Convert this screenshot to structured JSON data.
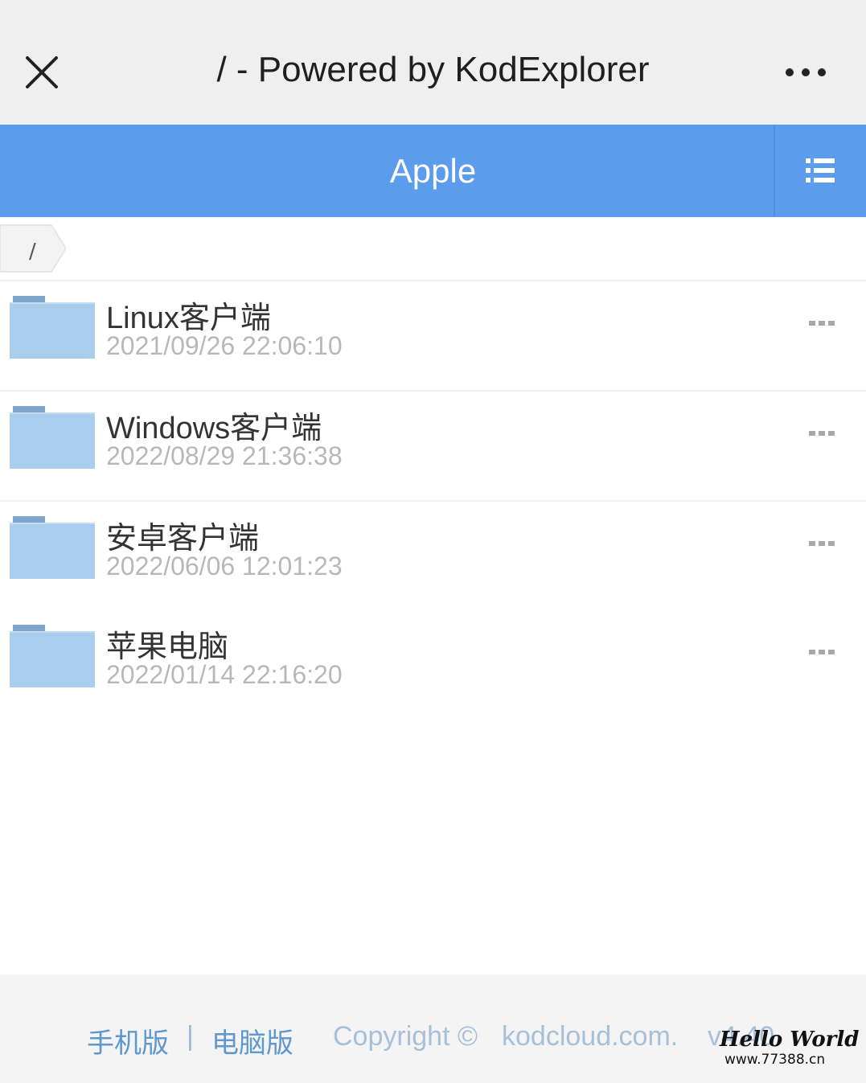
{
  "browser": {
    "title": "/ - Powered by KodExplorer",
    "close_icon": "close-icon",
    "more_icon": "more-icon"
  },
  "header": {
    "title": "Apple",
    "menu_icon": "list-menu-icon"
  },
  "breadcrumb": {
    "path": "/"
  },
  "files": [
    {
      "name": "Linux客户端",
      "date": "2021/09/26 22:06:10",
      "icon": "folder-icon"
    },
    {
      "name": "Windows客户端",
      "date": "2022/08/29 21:36:38",
      "icon": "folder-icon"
    },
    {
      "name": "安卓客户端",
      "date": "2022/06/06 12:01:23",
      "icon": "folder-icon"
    },
    {
      "name": "苹果电脑",
      "date": "2022/01/14 22:16:20",
      "icon": "folder-icon"
    }
  ],
  "footer": {
    "mobile_link": "手机版",
    "separator": "|",
    "desktop_link": "电脑版",
    "copyright_prefix": "Copyright ©",
    "copyright_domain": "kodcloud.com.",
    "version": "v4.40"
  },
  "watermark": {
    "title": "Hello World",
    "url": "www.77388.cn"
  },
  "colors": {
    "header_blue": "#5b9dec",
    "folder_blue": "#a9cdec",
    "folder_tab": "#7ea6cc",
    "link_blue": "#5f97cf"
  }
}
